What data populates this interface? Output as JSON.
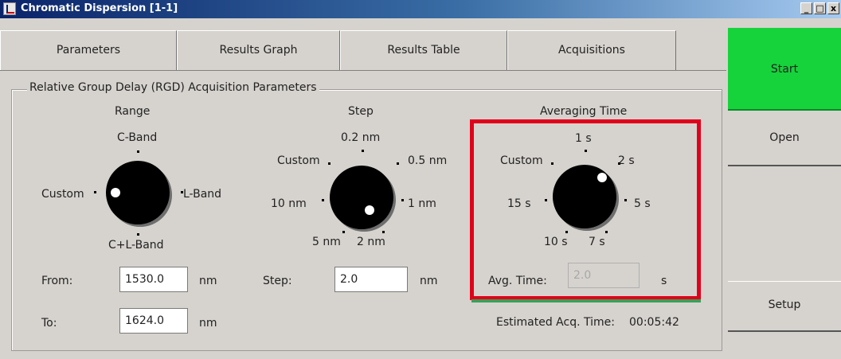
{
  "window": {
    "title": "Chromatic Dispersion [1-1]",
    "controls": [
      "_",
      "□",
      "x"
    ]
  },
  "tabs": [
    {
      "label": "Parameters",
      "selected": true
    },
    {
      "label": "Results Graph",
      "selected": false
    },
    {
      "label": "Results Table",
      "selected": false
    },
    {
      "label": "Acquisitions",
      "selected": false
    }
  ],
  "group": {
    "title": "Relative Group Delay (RGD) Acquisition Parameters"
  },
  "range": {
    "heading": "Range",
    "positions": {
      "top": "C-Band",
      "left": "Custom",
      "right": "L-Band",
      "bottom": "C+L-Band"
    },
    "selected": "Custom",
    "from_label": "From:",
    "from_value": "1530.0",
    "from_unit": "nm",
    "to_label": "To:",
    "to_value": "1624.0",
    "to_unit": "nm"
  },
  "step": {
    "heading": "Step",
    "positions": {
      "top": "0.2 nm",
      "top_left": "Custom",
      "top_right": "0.5 nm",
      "left": "10 nm",
      "right": "1 nm",
      "bottom_left": "5 nm",
      "bottom_right": "2 nm"
    },
    "selected": "2 nm",
    "step_label": "Step:",
    "step_value": "2.0",
    "step_unit": "nm"
  },
  "averaging": {
    "heading": "Averaging Time",
    "positions": {
      "top": "1 s",
      "top_left": "Custom",
      "top_right": "2 s",
      "left": "15 s",
      "right": "5 s",
      "bottom_left": "10 s",
      "bottom_right": "7 s"
    },
    "selected": "2 s",
    "avg_label": "Avg. Time:",
    "avg_value": "2.0",
    "avg_unit": "s",
    "highlight_color": "#e0001b"
  },
  "estimate": {
    "label": "Estimated Acq. Time:",
    "value": "00:05:42"
  },
  "sidebar": {
    "start_label": "Start",
    "open_label": "Open",
    "setup_label": "Setup",
    "start_color": "#16d33c"
  }
}
